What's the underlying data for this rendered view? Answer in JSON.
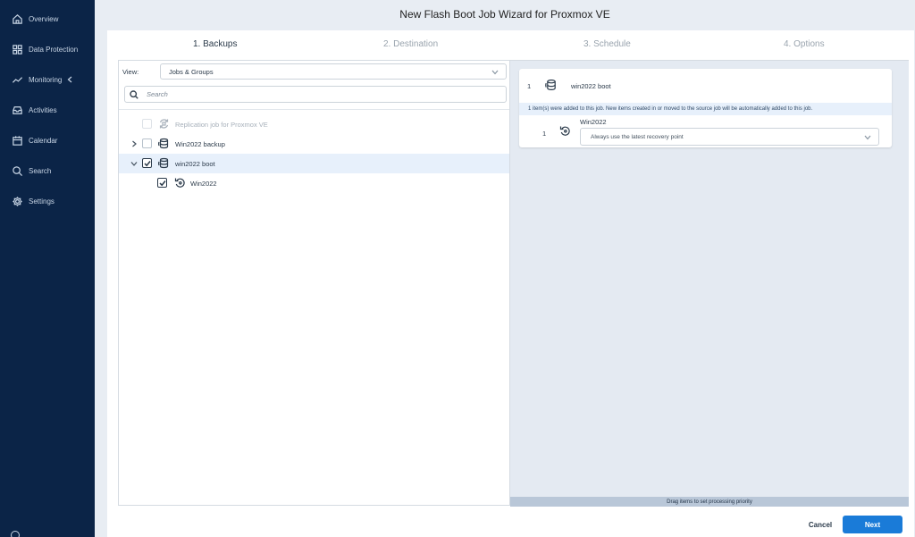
{
  "window": {
    "title": "New Flash Boot Job Wizard for Proxmox VE"
  },
  "sidebar": {
    "items": [
      {
        "label": "Overview",
        "icon": "home-icon"
      },
      {
        "label": "Data Protection",
        "icon": "grid-icon"
      },
      {
        "label": "Monitoring",
        "icon": "trend-icon"
      },
      {
        "label": "Activities",
        "icon": "inbox-icon"
      },
      {
        "label": "Calendar",
        "icon": "calendar-icon"
      },
      {
        "label": "Search",
        "icon": "search-icon"
      },
      {
        "label": "Settings",
        "icon": "gear-icon"
      }
    ]
  },
  "steps": [
    "1. Backups",
    "2. Destination",
    "3. Schedule",
    "4. Options"
  ],
  "left": {
    "view_label": "View:",
    "view_value": "Jobs & Groups",
    "search_placeholder": "Search",
    "tree": [
      {
        "label": "Replication job for Proxmox VE",
        "state": "disabled",
        "icon": "replication-icon"
      },
      {
        "label": "Win2022 backup",
        "state": "unchecked",
        "icon": "backup-job-icon"
      },
      {
        "label": "win2022 boot",
        "state": "checked",
        "icon": "backup-job-icon"
      },
      {
        "label": "Win2022",
        "state": "checked",
        "icon": "recovery-point-icon"
      }
    ]
  },
  "right": {
    "card": {
      "index": "1",
      "title": "win2022 boot",
      "info": "1 item(s) were added to this job. New items created in or moved to the source job will be automatically added to this job.",
      "item_index": "1",
      "item_name": "Win2022",
      "recovery_point": "Always use the latest recovery point"
    },
    "drag_hint": "Drag items to set processing priority"
  },
  "footer": {
    "cancel": "Cancel",
    "next": "Next"
  }
}
